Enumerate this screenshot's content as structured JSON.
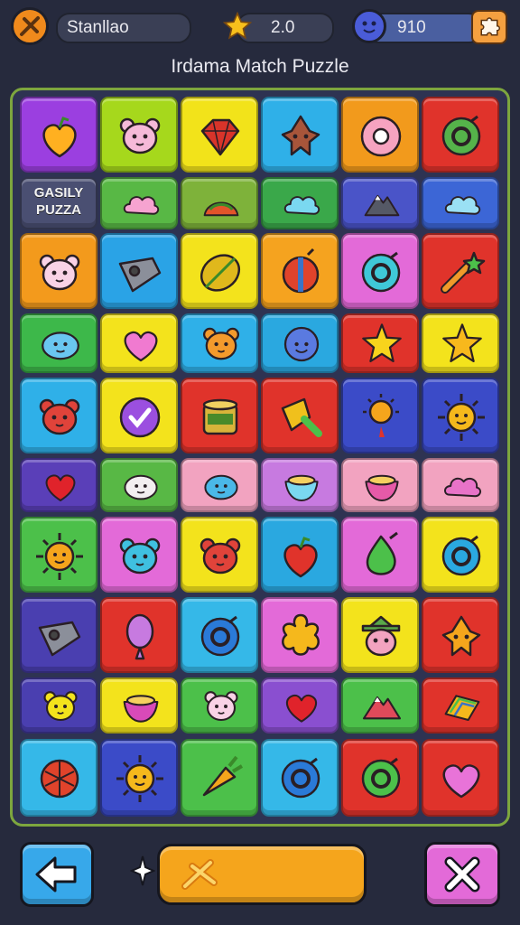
{
  "header": {
    "player_name": "Stanllao",
    "stars_value": "2.0",
    "gems_value": "910",
    "icons": [
      "tool-coin-icon",
      "star-icon",
      "gem-face-icon",
      "puzzle-piece-icon"
    ]
  },
  "game_title": "Irdama Match Puzzle",
  "board": {
    "rows": [
      [
        {
          "icon": "heart-fruit",
          "color": "#9b3fe0",
          "glyph": "#ffb020"
        },
        {
          "icon": "bear-face",
          "color": "#a6d81c",
          "glyph": "#f6b9d8"
        },
        {
          "icon": "gem",
          "color": "#f2e31a",
          "glyph": "#d8342a"
        },
        {
          "icon": "critter",
          "color": "#2fb0e8",
          "glyph": "#a8553a"
        },
        {
          "icon": "donut",
          "color": "#f29a1c",
          "glyph": "#f6a3c0"
        },
        {
          "icon": "ring",
          "color": "#e0332b",
          "glyph": "#55b34a"
        }
      ],
      [
        {
          "icon": "text",
          "color": "#4a4f72",
          "text": "GASILY PUZZA"
        },
        {
          "icon": "cloud",
          "color": "#58b845",
          "glyph": "#f6a3d0"
        },
        {
          "icon": "hill",
          "color": "#7eb23a",
          "glyph": "#e2542a"
        },
        {
          "icon": "cloud",
          "color": "#3aa84a",
          "glyph": "#7ad8f0"
        },
        {
          "icon": "mountain",
          "color": "#4a54c8",
          "glyph": "#555966"
        },
        {
          "icon": "cloud",
          "color": "#3c66d6",
          "glyph": "#9ae0f4"
        }
      ],
      [
        {
          "icon": "bear-face",
          "color": "#f39a1c",
          "glyph": "#f9d2e6"
        },
        {
          "icon": "tank",
          "color": "#2aa3e6",
          "glyph": "#8b8f9a"
        },
        {
          "icon": "lemon",
          "color": "#f3e31c",
          "glyph": "#e0b81c"
        },
        {
          "icon": "ball",
          "color": "#f5a31f",
          "glyph": "#e0432b"
        },
        {
          "icon": "ring",
          "color": "#e36ad8",
          "glyph": "#3fc8d8"
        },
        {
          "icon": "wand",
          "color": "#e0332b",
          "glyph": "#f09a2a"
        }
      ],
      [
        {
          "icon": "blob",
          "color": "#3db84a",
          "glyph": "#6ac6f0"
        },
        {
          "icon": "heart",
          "color": "#f3e31c",
          "glyph": "#f07ad0"
        },
        {
          "icon": "bear-face",
          "color": "#2fb0e8",
          "glyph": "#f39a2c"
        },
        {
          "icon": "smile-ball",
          "color": "#2aa8e0",
          "glyph": "#5a7ae0"
        },
        {
          "icon": "star",
          "color": "#e0332b",
          "glyph": "#f8d41c"
        },
        {
          "icon": "star",
          "color": "#f3e31c",
          "glyph": "#f8b81c"
        }
      ],
      [
        {
          "icon": "bear-face",
          "color": "#2fb0e8",
          "glyph": "#e0433a"
        },
        {
          "icon": "check",
          "color": "#f3e31c",
          "glyph": "#9b4fe0"
        },
        {
          "icon": "can",
          "color": "#e0332b",
          "glyph": "#d9b43a"
        },
        {
          "icon": "ice",
          "color": "#e0332b",
          "glyph": "#f0c01c"
        },
        {
          "icon": "sun-lamp",
          "color": "#3b4bc8",
          "glyph": "#f5a51c"
        },
        {
          "icon": "sun",
          "color": "#3b4bc8",
          "glyph": "#f5b81c"
        }
      ],
      [
        {
          "icon": "heart",
          "color": "#5a3fb8",
          "glyph": "#e0232b",
          "short": true
        },
        {
          "icon": "blob",
          "color": "#58b845",
          "glyph": "#f3eef0",
          "short": true
        },
        {
          "icon": "blob",
          "color": "#f2a3c0",
          "glyph": "#4ab8e8",
          "short": true
        },
        {
          "icon": "bowl",
          "color": "#c77ae0",
          "glyph": "#7ad8f0",
          "short": true
        },
        {
          "icon": "bowl",
          "color": "#f2a3c0",
          "glyph": "#e65aa8",
          "short": true
        },
        {
          "icon": "cloud",
          "color": "#f2a3c0",
          "glyph": "#e873c8",
          "short": true
        }
      ],
      [
        {
          "icon": "sun",
          "color": "#4cc04a",
          "glyph": "#f5a51c"
        },
        {
          "icon": "bear-face",
          "color": "#e36ad8",
          "glyph": "#3fc0e0"
        },
        {
          "icon": "bear-face",
          "color": "#f3e31c",
          "glyph": "#e0433a"
        },
        {
          "icon": "heart-fruit",
          "color": "#2aa8e0",
          "glyph": "#e0332b"
        },
        {
          "icon": "drop",
          "color": "#e36ad8",
          "glyph": "#4cc04a"
        },
        {
          "icon": "ring",
          "color": "#f3e31c",
          "glyph": "#2aa8e0"
        }
      ],
      [
        {
          "icon": "tank",
          "color": "#4a3fb0",
          "glyph": "#8b8f9a"
        },
        {
          "icon": "balloon",
          "color": "#e0332b",
          "glyph": "#c77ae0"
        },
        {
          "icon": "ring",
          "color": "#35b8e8",
          "glyph": "#2a7ad8"
        },
        {
          "icon": "flower",
          "color": "#e36ad8",
          "glyph": "#f5b81c"
        },
        {
          "icon": "hat-face",
          "color": "#f3e31c",
          "glyph": "#f2a3c0"
        },
        {
          "icon": "critter",
          "color": "#e0332b",
          "glyph": "#f5a51c"
        }
      ],
      [
        {
          "icon": "bear-face",
          "color": "#4a3fb0",
          "glyph": "#f3e31c",
          "short": true
        },
        {
          "icon": "bowl",
          "color": "#f3e31c",
          "glyph": "#d84ab8",
          "short": true
        },
        {
          "icon": "bear-face",
          "color": "#4cc04a",
          "glyph": "#f9d2e6",
          "short": true
        },
        {
          "icon": "heart",
          "color": "#8a4fd0",
          "glyph": "#e0232b",
          "short": true
        },
        {
          "icon": "mountain",
          "color": "#4cc04a",
          "glyph": "#e04a5a",
          "short": true
        },
        {
          "icon": "rainbow",
          "color": "#e0332b",
          "glyph": "#f5b81c",
          "short": true
        }
      ],
      [
        {
          "icon": "basket",
          "color": "#35b8e8",
          "glyph": "#e0432b"
        },
        {
          "icon": "sun",
          "color": "#3b4bc8",
          "glyph": "#f5b81c"
        },
        {
          "icon": "carrot",
          "color": "#4cc04a",
          "glyph": "#f5a51c"
        },
        {
          "icon": "ring",
          "color": "#35b8e8",
          "glyph": "#2a7ad8"
        },
        {
          "icon": "ring",
          "color": "#e0332b",
          "glyph": "#4cc04a"
        },
        {
          "icon": "heart",
          "color": "#e0332b",
          "glyph": "#e873d8"
        }
      ]
    ]
  },
  "footer": {
    "back_icon": "arrow-left-icon",
    "action_icon": "tool-icon",
    "close_icon": "close-x-icon",
    "sparkle_icon": "sparkle-icon"
  }
}
